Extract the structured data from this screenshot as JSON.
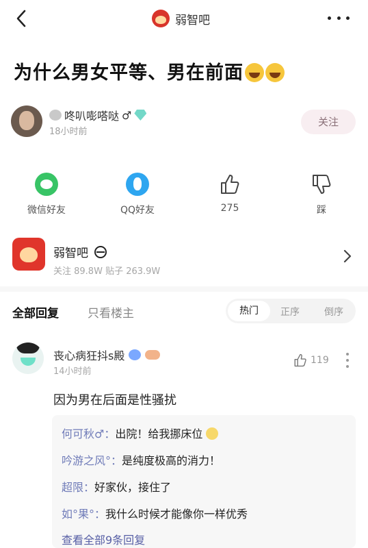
{
  "header": {
    "forum_chip_label": "弱智吧"
  },
  "post": {
    "title": "为什么男女平等、男在前面",
    "author_name": "咚叭嘭嗒哒",
    "author_name_suffix": "♂",
    "time": "18小时前",
    "follow_label": "关注"
  },
  "share": {
    "wechat_label": "微信好友",
    "qq_label": "QQ好友",
    "like_count": "275",
    "dislike_label": "踩"
  },
  "forum": {
    "name": "弱智吧",
    "stats": "关注 89.8W  贴子 263.9W"
  },
  "tabs": {
    "all_label": "全部回复",
    "op_only_label": "只看楼主",
    "sort_hot": "热门",
    "sort_asc": "正序",
    "sort_desc": "倒序"
  },
  "comment": {
    "author_name": "丧心病狂抖s殿",
    "time": "14小时前",
    "like_count": "119",
    "text": "因为男在后面是性骚扰",
    "replies": [
      {
        "who": "何可秋♂：",
        "text": "出院！给我挪床位"
      },
      {
        "who": "吟游之风°：",
        "text": "是纯度极高的消力！"
      },
      {
        "who": "超限：",
        "text": "好家伙，接住了"
      },
      {
        "who": "如°果°：",
        "text": "我什么时候才能像你一样优秀"
      }
    ],
    "view_all_label": "查看全部9条回复"
  }
}
